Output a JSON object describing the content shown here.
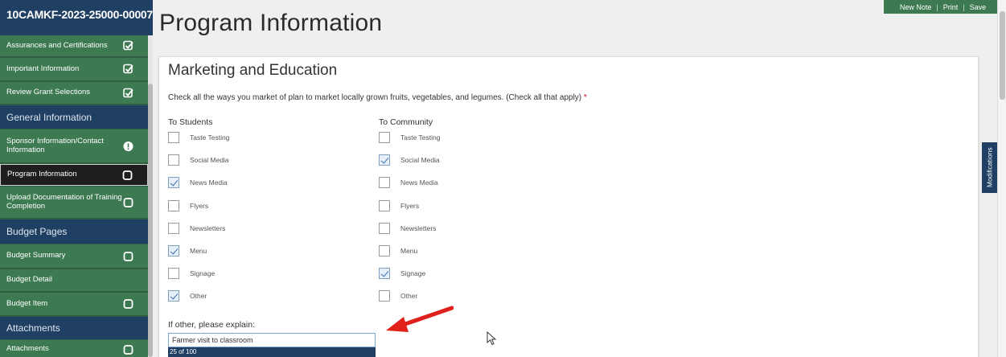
{
  "sidebar": {
    "header": "10CAMKF-2023-25000-00007",
    "items": [
      {
        "label": "Assurances and Certifications",
        "status": "check"
      },
      {
        "label": "Important Information",
        "status": "check"
      },
      {
        "label": "Review Grant Selections",
        "status": "check"
      },
      {
        "label": "General Information",
        "type": "section"
      },
      {
        "label": "Sponsor Information/Contact Information",
        "status": "alert"
      },
      {
        "label": "Program Information",
        "status": "empty"
      },
      {
        "label": "Upload Documentation of Training Completion",
        "status": "empty"
      },
      {
        "label": "Budget Pages",
        "type": "section"
      },
      {
        "label": "Budget Summary",
        "status": "empty"
      },
      {
        "label": "Budget Detail",
        "status": ""
      },
      {
        "label": "Budget Item",
        "status": "empty"
      },
      {
        "label": "Attachments",
        "type": "section"
      },
      {
        "label": "Attachments",
        "status": "empty"
      }
    ]
  },
  "page": {
    "title": "Program Information"
  },
  "toolbar": {
    "new_note": "New Note",
    "sep": "|",
    "print": "Print",
    "save": "Save"
  },
  "modifications_tab": "Modifications",
  "section": {
    "title": "Marketing and Education",
    "question": "Check all the ways you market of plan to market locally grown fruits, vegetables, and legumes. (Check all that apply)",
    "required_mark": "*",
    "students": {
      "heading": "To Students",
      "options": [
        {
          "label": "Taste Testing",
          "checked": false
        },
        {
          "label": "Social Media",
          "checked": false
        },
        {
          "label": "News Media",
          "checked": true
        },
        {
          "label": "Flyers",
          "checked": false
        },
        {
          "label": "Newsletters",
          "checked": false
        },
        {
          "label": "Menu",
          "checked": true
        },
        {
          "label": "Signage",
          "checked": false
        },
        {
          "label": "Other",
          "checked": true
        }
      ]
    },
    "community": {
      "heading": "To Community",
      "options": [
        {
          "label": "Taste Testing",
          "checked": false
        },
        {
          "label": "Social Media",
          "checked": true
        },
        {
          "label": "News Media",
          "checked": false
        },
        {
          "label": "Flyers",
          "checked": false
        },
        {
          "label": "Newsletters",
          "checked": false
        },
        {
          "label": "Menu",
          "checked": false
        },
        {
          "label": "Signage",
          "checked": true
        },
        {
          "label": "Other",
          "checked": false
        }
      ]
    },
    "explain_label": "If other, please explain:",
    "explain_value": "Farmer visit to classroom",
    "char_counter": "25 of 100"
  },
  "colors": {
    "sidebar_green": "#3d7a52",
    "sidebar_navy": "#1f3f63",
    "arrow_red": "#e0201b"
  }
}
